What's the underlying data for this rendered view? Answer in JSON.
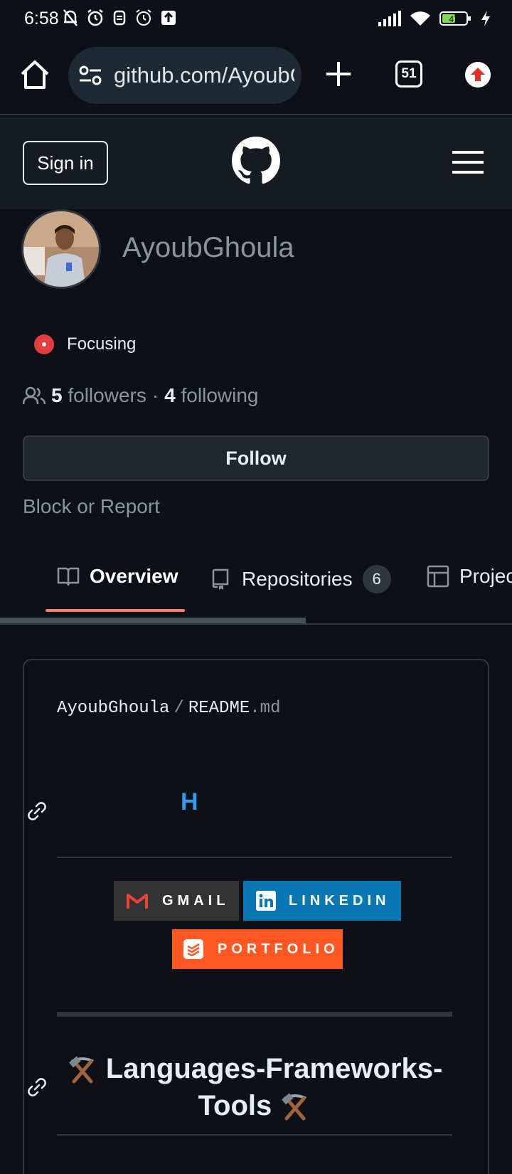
{
  "status_bar": {
    "time": "6:58",
    "battery": "47"
  },
  "browser": {
    "url": "github.com/AyoubGhoula",
    "tab_count": "51"
  },
  "header": {
    "sign_in_label": "Sign in"
  },
  "profile": {
    "username": "AyoubGhoula",
    "status_text": "Focusing",
    "followers_count": "5",
    "followers_label": "followers",
    "separator": "·",
    "following_count": "4",
    "following_label": "following",
    "follow_label": "Follow",
    "block_label": "Block or Report"
  },
  "tabs": [
    {
      "label": "Overview",
      "icon": "book-icon"
    },
    {
      "label": "Repositories",
      "count": "6",
      "icon": "repo-icon"
    },
    {
      "label": "Projects",
      "icon": "table-icon"
    }
  ],
  "readme": {
    "owner": "AyoubGhoula",
    "path_sep": "/",
    "file_name": "README",
    "file_ext": ".md",
    "heading_h": "H",
    "badges": [
      {
        "label": "GMAIL",
        "color": "#333333"
      },
      {
        "label": "LINKEDIN",
        "color": "#0a77b5"
      },
      {
        "label": "PORTFOLIO",
        "color": "#ff5722"
      }
    ],
    "languages_heading": "Languages-Frameworks-Tools"
  }
}
